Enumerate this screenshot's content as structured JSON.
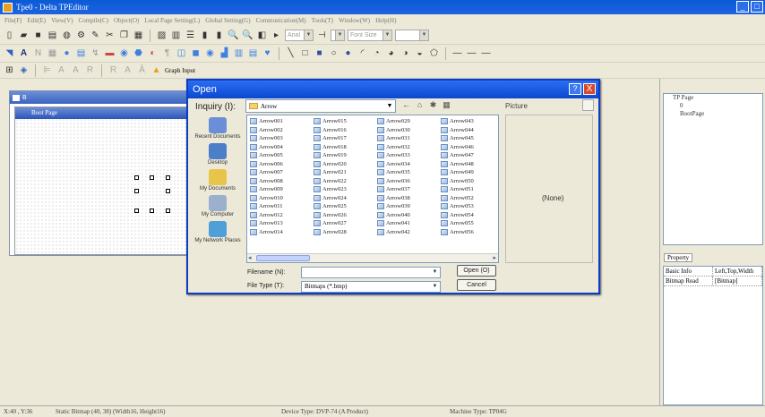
{
  "window": {
    "title": "Tpe0 - Delta TPEditor",
    "min": "_",
    "close": "□"
  },
  "menu": [
    "File(F)",
    "Edit(E)",
    "View(V)",
    "Compile(C)",
    "Object(O)",
    "Local Page Setting(L)",
    "Global Setting(G)",
    "Communication(M)",
    "Tools(T)",
    "Window(W)",
    "Help(H)"
  ],
  "toolbar": {
    "font_label": "Arial",
    "font_size_label": "Font Size",
    "graph_label": "Graph Input"
  },
  "doc": {
    "title": "B",
    "page_title": "Boot Page"
  },
  "tree": {
    "items": [
      "TP Page",
      "0",
      "BootPage"
    ]
  },
  "properties": {
    "tab": "Property",
    "rows": [
      [
        "Basic Info",
        "Left,Top,Width"
      ],
      [
        "Bitmap Read",
        "[Bitmap]"
      ]
    ]
  },
  "status": {
    "coords": "X:40 , Y:36",
    "static": "Static Bitmap (40, 38) (Width16, Height16)",
    "device": "Device Type: DVP-74 (A Product)",
    "machine": "Machine Type: TP04G"
  },
  "dialog": {
    "title": "Open",
    "help": "?",
    "close": "X",
    "lookin_label": "Inquiry (I):",
    "lookin_value": "Arrow",
    "preview_label": "Picture",
    "preview_value": "(None)",
    "places": [
      {
        "label": "Recent Documents",
        "color": "#6b8fd6"
      },
      {
        "label": "Desktop",
        "color": "#4d7fc9"
      },
      {
        "label": "My Documents",
        "color": "#e8c54a"
      },
      {
        "label": "My Computer",
        "color": "#9ab0cc"
      },
      {
        "label": "My Network Places",
        "color": "#4f9fd8"
      }
    ],
    "files": [
      [
        "Arrow001",
        "Arrow002",
        "Arrow003",
        "Arrow004",
        "Arrow005",
        "Arrow006",
        "Arrow007",
        "Arrow008",
        "Arrow009",
        "Arrow010",
        "Arrow011",
        "Arrow012",
        "Arrow013",
        "Arrow014"
      ],
      [
        "Arrow015",
        "Arrow016",
        "Arrow017",
        "Arrow018",
        "Arrow019",
        "Arrow020",
        "Arrow021",
        "Arrow022",
        "Arrow023",
        "Arrow024",
        "Arrow025",
        "Arrow026",
        "Arrow027",
        "Arrow028"
      ],
      [
        "Arrow029",
        "Arrow030",
        "Arrow031",
        "Arrow032",
        "Arrow033",
        "Arrow034",
        "Arrow035",
        "Arrow036",
        "Arrow037",
        "Arrow038",
        "Arrow039",
        "Arrow040",
        "Arrow041",
        "Arrow042"
      ],
      [
        "Arrow043",
        "Arrow044",
        "Arrow045",
        "Arrow046",
        "Arrow047",
        "Arrow048",
        "Arrow049",
        "Arrow050",
        "Arrow051",
        "Arrow052",
        "Arrow053",
        "Arrow054",
        "Arrow055",
        "Arrow056"
      ]
    ],
    "filename_label": "Filename (N):",
    "filename_value": "",
    "filetype_label": "File Type (T):",
    "filetype_value": "Bitmaps (*.bmp)",
    "open_label": "Open (O)",
    "cancel_label": "Cancel"
  }
}
